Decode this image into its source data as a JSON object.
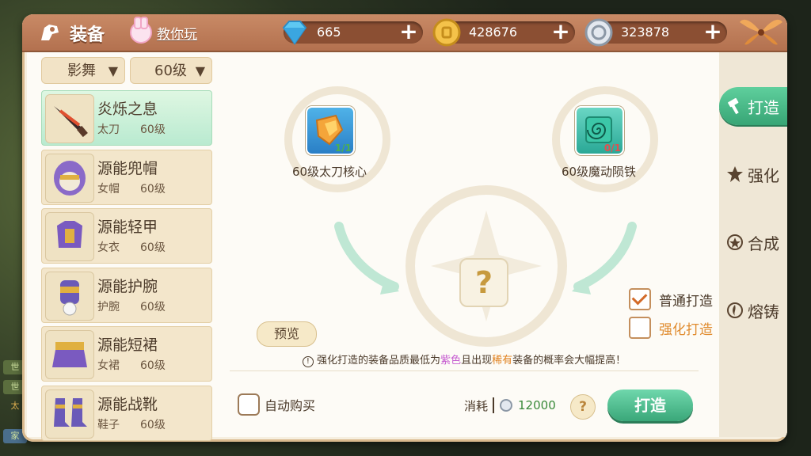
{
  "header": {
    "title": "装备",
    "tutorial_label": "教你玩",
    "currencies": [
      {
        "name": "diamond",
        "value": "665",
        "icon": "diamond-icon"
      },
      {
        "name": "gold",
        "value": "428676",
        "icon": "gold-coin-icon"
      },
      {
        "name": "silver",
        "value": "323878",
        "icon": "silver-coin-icon"
      }
    ]
  },
  "game_bg": {
    "chat1": "世",
    "chat2": "世",
    "chat3": "太",
    "chat4": "家"
  },
  "filters": {
    "class": "影舞",
    "level": "60级",
    "arrow": "▼"
  },
  "equipment_list": [
    {
      "name": "炎烁之息",
      "type": "太刀",
      "level": "60级",
      "selected": true
    },
    {
      "name": "源能兜帽",
      "type": "女帽",
      "level": "60级",
      "selected": false
    },
    {
      "name": "源能轻甲",
      "type": "女衣",
      "level": "60级",
      "selected": false
    },
    {
      "name": "源能护腕",
      "type": "护腕",
      "level": "60级",
      "selected": false
    },
    {
      "name": "源能短裙",
      "type": "女裙",
      "level": "60级",
      "selected": false
    },
    {
      "name": "源能战靴",
      "type": "鞋子",
      "level": "60级",
      "selected": false
    }
  ],
  "materials": [
    {
      "name": "60级太刀核心",
      "count": "1/1",
      "count_color": "#4caf50"
    },
    {
      "name": "60级魔动陨铁",
      "count": "0/1",
      "count_color": "#e05050"
    }
  ],
  "result_symbol": "?",
  "preview_label": "预览",
  "options": {
    "normal": {
      "label": "普通打造",
      "checked": true
    },
    "enhanced": {
      "label": "强化打造",
      "checked": false
    }
  },
  "notice": {
    "prefix": "强化打造的装备品质最低为",
    "purple": "紫色",
    "middle": "且出现",
    "rare": "稀有",
    "suffix": "装备的概率会大幅提高！"
  },
  "auto_buy_label": "自动购买",
  "cost": {
    "label": "消耗",
    "amount": "12000"
  },
  "help_label": "?",
  "forge_label": "打造",
  "tabs": [
    {
      "label": "打造",
      "active": true
    },
    {
      "label": "强化",
      "active": false
    },
    {
      "label": "合成",
      "active": false
    },
    {
      "label": "熔铸",
      "active": false
    }
  ],
  "colors": {
    "accent": "#3aa779",
    "header": "#b3714f",
    "purple": "#c55bd0",
    "orange": "#e0801e"
  }
}
